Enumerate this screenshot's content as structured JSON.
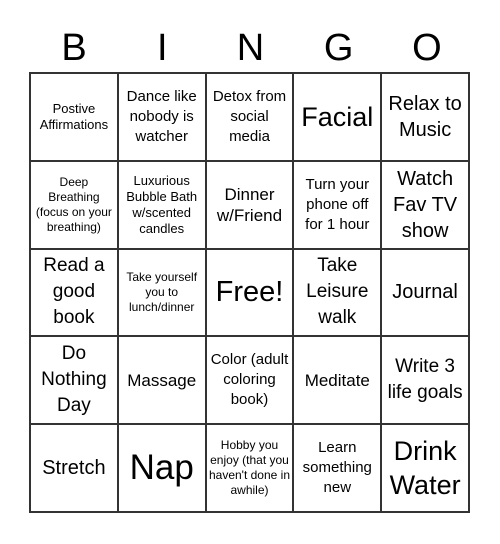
{
  "header": {
    "letters": [
      "B",
      "I",
      "N",
      "G",
      "O"
    ]
  },
  "cells": [
    "Postive Affirmations",
    "Dance like nobody is watcher",
    "Detox from social media",
    "Facial",
    "Relax to Music",
    "Deep Breathing (focus on your breathing)",
    "Luxurious Bubble Bath w/scented candles",
    "Dinner w/Friend",
    "Turn your phone off for 1 hour",
    "Watch Fav TV show",
    "Read a good book",
    "Take yourself you to lunch/dinner",
    "Free!",
    "Take Leisure walk",
    "Journal",
    "Do Nothing Day",
    "Massage",
    "Color (adult coloring book)",
    "Meditate",
    "Write 3 life goals",
    "Stretch",
    "Nap",
    "Hobby you enjoy (that you haven't done in awhile)",
    "Learn something new",
    "Drink Water"
  ]
}
